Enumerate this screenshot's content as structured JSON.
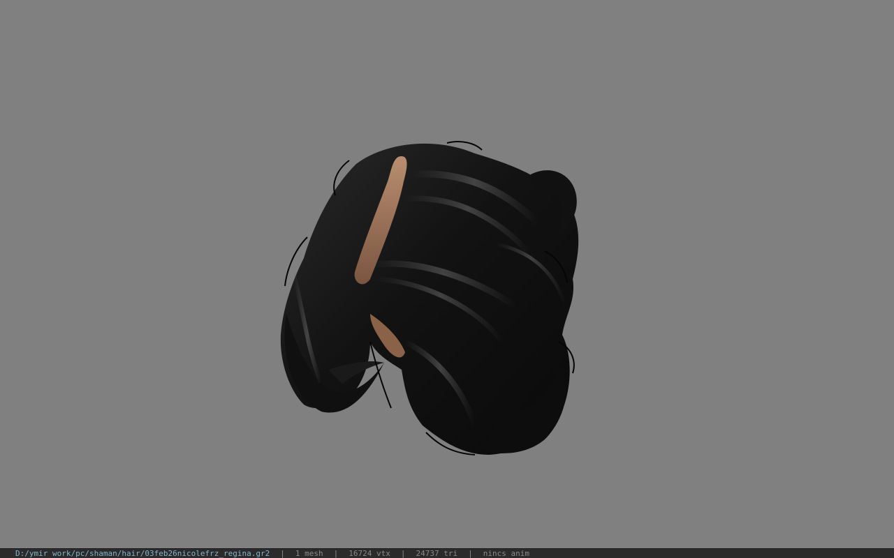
{
  "viewport": {
    "background_color": "#808080",
    "model_subject": "black hairstyle mesh"
  },
  "statusbar": {
    "file_path": "D:/ymir work/pc/shaman/hair/03feb26nicolefrz_regina.gr2",
    "separator": "|",
    "mesh_count": "1 mesh",
    "vertex_count": "16724 vtx",
    "triangle_count": "24737 tri",
    "anim_status": "nincs anim"
  },
  "colors": {
    "hair": "#141414",
    "hair_highlight": "#5a5a5a",
    "scalp": "#a57a5e",
    "path_text": "#7fb6cf",
    "status_text": "#8a8a8a",
    "statusbar_bg": "#2b2b2b"
  }
}
